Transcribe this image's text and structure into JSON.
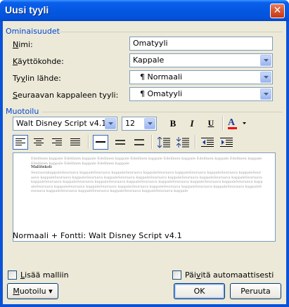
{
  "window": {
    "title": "Uusi tyyli",
    "close_glyph": "✕"
  },
  "properties": {
    "group_label": "Ominaisuudet",
    "name_label_u": "N",
    "name_label_rest": "imi:",
    "name_value": "Omatyyli",
    "type_label_u": "K",
    "type_label_rest": "äyttökohde:",
    "type_value": "Kappale",
    "based_label_pre": "Ty",
    "based_label_u": "y",
    "based_label_rest": "lin lähde:",
    "based_value": "Normaali",
    "next_label_u": "S",
    "next_label_rest": "euraavan kappaleen tyyli:",
    "next_value": "Omatyyli",
    "paragraph_mark": "¶"
  },
  "formatting": {
    "group_label": "Muotoilu",
    "font_value": "Walt Disney Script v4.1",
    "size_value": "12",
    "bold_glyph": "B",
    "italic_glyph": "I",
    "underline_glyph": "U",
    "font_color_glyph": "A",
    "font_color": "#ff0000",
    "accent_color": "#316ac5"
  },
  "preview": {
    "previous_text": "Edellinen kappale Edellinen kappale Edellinen kappale Edellinen kappale Edellinen kappale Edellinen kappale Edellinen kappale Edellinen kappale Edellinen kappale Edellinen kappale",
    "sample_text": "Malliteksti",
    "following_text": "SeuraavakappaleSeuraava kappaleSeuraava kappaleSeuraava kappaleSeuraava kappaleSeuraava kappaleSeuraava kappaleSeuraava kappaleSeuraava kappaleSeuraava kappaleSeuraava kappaleSeuraava kappaleSeuraava kappaleSeuraava kappaleSeuraava kappaleSeuraava kappaleSeuraava kappaleSeuraava kappaleSeuraava kappaleSeuraava kappaleSeuraava kappaleSeuraava kappaleSeuraava kappaleSeuraava kappaleSeuraava kappaleSeuraava kappaleSeuraava kappaleSeuraava kappaleSeuraava kappaleSeuraava kappaleSeuraava kappaleSeuraava kappaleSeuraava kappaleSeuraava kappale"
  },
  "description": "Normaali + Fontti: Walt Disney Script v4.1",
  "footer": {
    "add_template_u": "L",
    "add_template_rest": "isää malliin",
    "auto_update_pre": "Päi",
    "auto_update_u": "v",
    "auto_update_rest": "itä automaattisesti",
    "format_u": "M",
    "format_rest": "uotoilu",
    "format_arrow": "▾",
    "ok_label": "OK",
    "cancel_label": "Peruuta"
  }
}
